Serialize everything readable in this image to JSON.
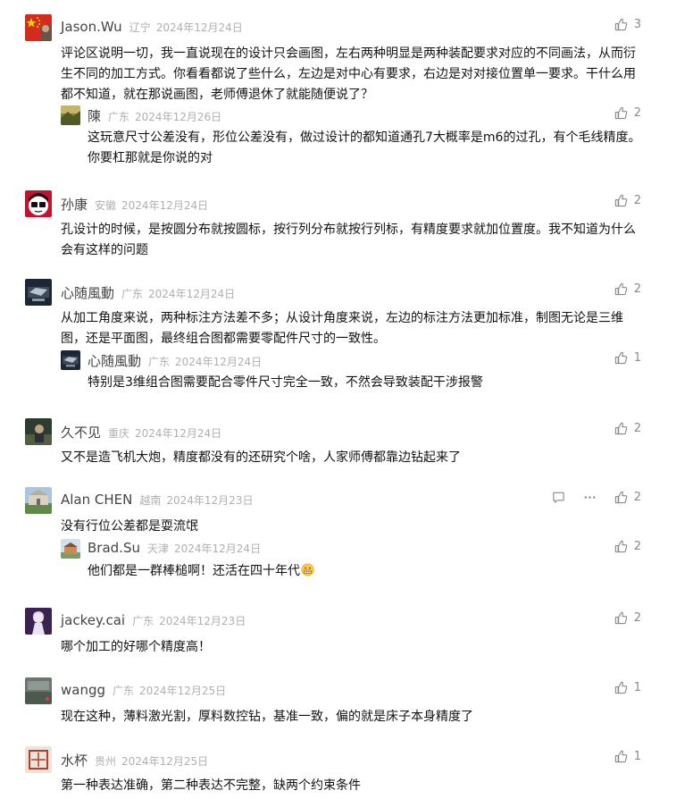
{
  "comments": [
    {
      "author": "Jason.Wu",
      "location": "辽宁",
      "date": "2024年12月24日",
      "likes": "3",
      "text": "评论区说明一切，我一直说现在的设计只会画图，左右两种明显是两种装配要求对应的不同画法，从而衍生不同的加工方式。你看看都说了些什么，左边是对中心有要求，右边是对对接位置单一要求。干什么用都不知道，就在那说画图，老师傅退休了就能随便说了？",
      "avatar_icon": "china-flag-avatar",
      "replies": [
        {
          "author": "陳",
          "location": "广东",
          "date": "2024年12月26日",
          "likes": "2",
          "text": "这玩意尺寸公差没有，形位公差没有，做过设计的都知道通孔7大概率是m6的过孔，有个毛线精度。你要杠那就是你说的对",
          "avatar_icon": "landscape-avatar"
        }
      ]
    },
    {
      "author": "孙康",
      "location": "安徽",
      "date": "2024年12月24日",
      "likes": "2",
      "text": "孔设计的时候，是按圆分布就按圆标，按行列分布就按行列标，有精度要求就加位置度。我不知道为什么会有这样的问题",
      "avatar_icon": "cartoon-face-avatar",
      "replies": []
    },
    {
      "author": "心随風動",
      "location": "广东",
      "date": "2024年12月24日",
      "likes": "2",
      "text": "从加工角度来说，两种标注方法差不多；从设计角度来说，左边的标注方法更加标准，制图无论是三维图，还是平面图，最终组合图都需要零配件尺寸的一致性。",
      "avatar_icon": "game-logo-avatar",
      "replies": [
        {
          "author": "心随風動",
          "location": "广东",
          "date": "2024年12月24日",
          "likes": "1",
          "text": "特别是3维组合图需要配合零件尺寸完全一致，不然会导致装配干涉报警",
          "avatar_icon": "game-logo-avatar"
        }
      ]
    },
    {
      "author": "久不见",
      "location": "重庆",
      "date": "2024年12月24日",
      "likes": "2",
      "text": "又不是造飞机大炮，精度都没有的还研究个啥，人家师傅都靠边钻起来了",
      "avatar_icon": "photo-avatar",
      "replies": []
    },
    {
      "author": "Alan CHEN",
      "location": "越南",
      "date": "2024年12月23日",
      "likes": "2",
      "text": "没有行位公差都是耍流氓",
      "avatar_icon": "building-avatar",
      "show_actions": true,
      "reply_icon": "comment-bubble-icon",
      "more_icon": "more-dots-icon",
      "replies": [
        {
          "author": "Brad.Su",
          "location": "天津",
          "date": "2024年12月24日",
          "likes": "2",
          "text": "他们都是一群棒槌啊！还活在四十年代",
          "emoji": "grin-emoji-icon",
          "avatar_icon": "house-avatar"
        }
      ]
    },
    {
      "author": "jackey.cai",
      "location": "广东",
      "date": "2024年12月23日",
      "likes": "2",
      "text": "哪个加工的好哪个精度高！",
      "avatar_icon": "anime-avatar",
      "replies": []
    },
    {
      "author": "wangg",
      "location": "广东",
      "date": "2024年12月25日",
      "likes": "1",
      "text": "现在这种，薄料激光割，厚料数控钻，基准一致，偏的就是床子本身精度了",
      "avatar_icon": "gray-photo-avatar",
      "replies": []
    },
    {
      "author": "水杯",
      "location": "贵州",
      "date": "2024年12月25日",
      "likes": "1",
      "text": "第一种表达准确，第二种表达不完整，缺两个约束条件",
      "avatar_icon": "seal-avatar",
      "replies": []
    }
  ],
  "like_icon": "thumbs-up-icon"
}
